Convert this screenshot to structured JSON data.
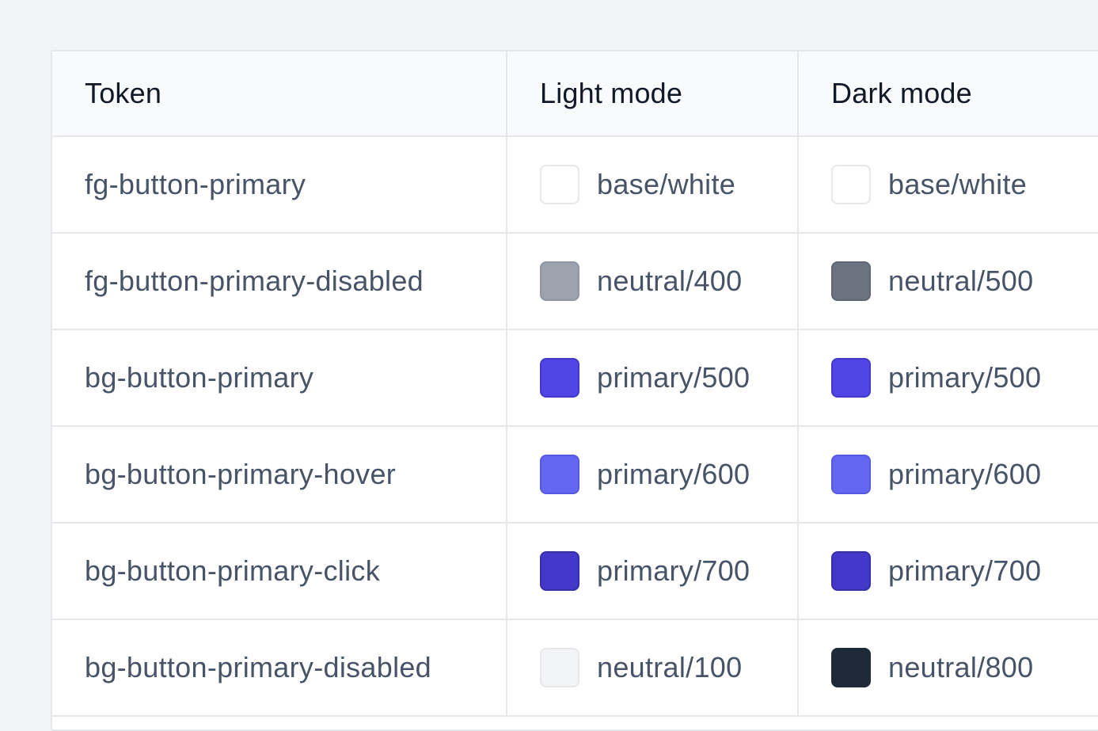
{
  "table": {
    "headers": {
      "token": "Token",
      "light": "Light mode",
      "dark": "Dark mode"
    },
    "rows": [
      {
        "token": "fg-button-primary",
        "light": {
          "label": "base/white",
          "color": "#ffffff",
          "border": "#e5e7eb"
        },
        "dark": {
          "label": "base/white",
          "color": "#ffffff",
          "border": "#e5e7eb"
        }
      },
      {
        "token": "fg-button-primary-disabled",
        "light": {
          "label": "neutral/400",
          "color": "#9ca3af",
          "border": "#8f96a3"
        },
        "dark": {
          "label": "neutral/500",
          "color": "#6b7280",
          "border": "#5f6673"
        }
      },
      {
        "token": "bg-button-primary",
        "light": {
          "label": "primary/500",
          "color": "#4f46e5",
          "border": "#4338ca"
        },
        "dark": {
          "label": "primary/500",
          "color": "#4f46e5",
          "border": "#4338ca"
        }
      },
      {
        "token": "bg-button-primary-hover",
        "light": {
          "label": "primary/600",
          "color": "#6366f1",
          "border": "#5558e0"
        },
        "dark": {
          "label": "primary/600",
          "color": "#6366f1",
          "border": "#5558e0"
        }
      },
      {
        "token": "bg-button-primary-click",
        "light": {
          "label": "primary/700",
          "color": "#4338ca",
          "border": "#3730a3"
        },
        "dark": {
          "label": "primary/700",
          "color": "#4338ca",
          "border": "#3730a3"
        }
      },
      {
        "token": "bg-button-primary-disabled",
        "light": {
          "label": "neutral/100",
          "color": "#f3f4f6",
          "border": "#e5e7eb"
        },
        "dark": {
          "label": "neutral/800",
          "color": "#1f2937",
          "border": "#1f2937"
        }
      }
    ]
  }
}
